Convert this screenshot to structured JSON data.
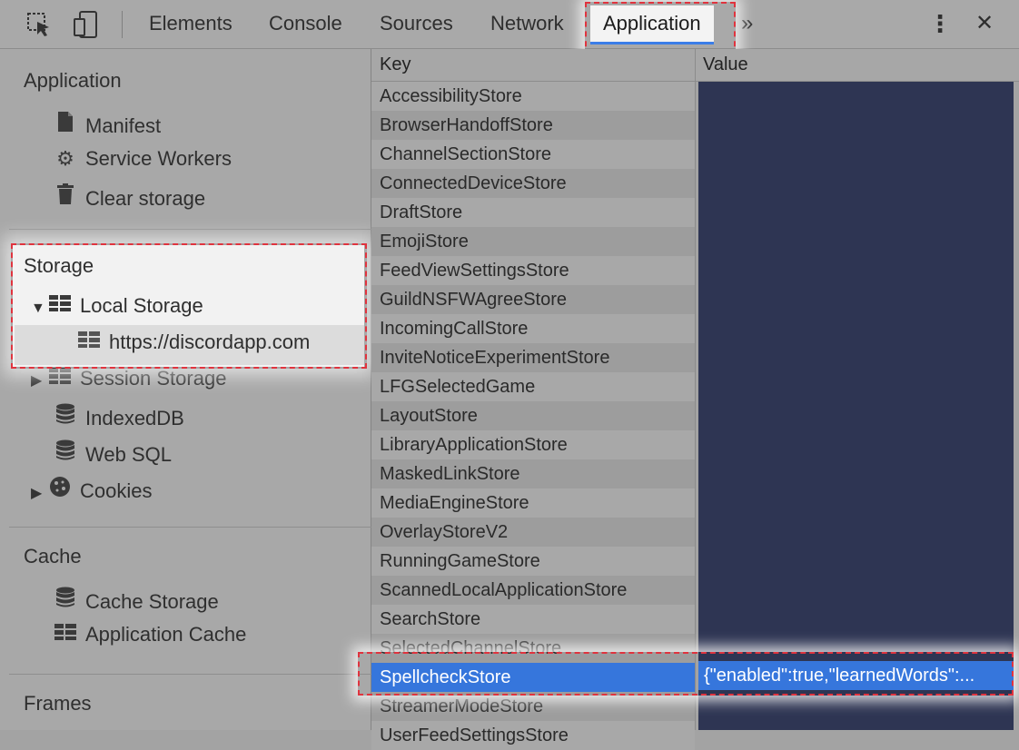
{
  "toolbar": {
    "tabs": [
      "Elements",
      "Console",
      "Sources",
      "Network"
    ],
    "active_tab": "Application",
    "more": "»",
    "menu": "⋮",
    "close": "✕"
  },
  "sidebar": {
    "application": {
      "title": "Application",
      "items": [
        "Manifest",
        "Service Workers",
        "Clear storage"
      ]
    },
    "storage": {
      "title": "Storage",
      "local_storage": "Local Storage",
      "origin": "https://discordapp.com",
      "items": [
        "Session Storage",
        "IndexedDB",
        "Web SQL",
        "Cookies"
      ]
    },
    "cache": {
      "title": "Cache",
      "items": [
        "Cache Storage",
        "Application Cache"
      ]
    },
    "frames": {
      "title": "Frames"
    }
  },
  "table": {
    "key_header": "Key",
    "value_header": "Value",
    "keys": [
      "AccessibilityStore",
      "BrowserHandoffStore",
      "ChannelSectionStore",
      "ConnectedDeviceStore",
      "DraftStore",
      "EmojiStore",
      "FeedViewSettingsStore",
      "GuildNSFWAgreeStore",
      "IncomingCallStore",
      "InviteNoticeExperimentStore",
      "LFGSelectedGame",
      "LayoutStore",
      "LibraryApplicationStore",
      "MaskedLinkStore",
      "MediaEngineStore",
      "OverlayStoreV2",
      "RunningGameStore",
      "ScannedLocalApplicationStore",
      "SearchStore",
      "SelectedChannelStore",
      "SpellcheckStore",
      "StreamerModeStore",
      "UserFeedSettingsStore"
    ],
    "selected_key": "SpellcheckStore",
    "selected_value": "{\"enabled\":true,\"learnedWords\":..."
  },
  "colors": {
    "highlight": "#e0333e",
    "selection": "#3676dc",
    "value_panel": "#2e3553"
  }
}
